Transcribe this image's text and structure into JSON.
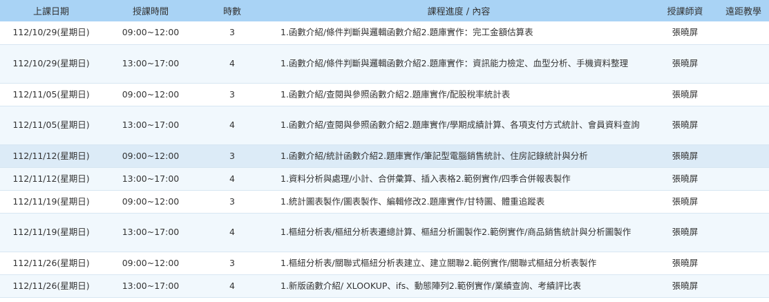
{
  "table": {
    "headers": [
      "上課日期",
      "授課時間",
      "時數",
      "課程進度 / 內容",
      "授課師資",
      "遠距教學"
    ],
    "rows": [
      {
        "date": "112/10/29(星期日)",
        "time": "09:00~12:00",
        "hours": "3",
        "content": "1.函數介紹/條件判斷與邏輯函數介紹2.題庫實作：完工金額估算表",
        "teacher": "張曉屏",
        "remote": ""
      },
      {
        "date": "112/10/29(星期日)",
        "time": "13:00~17:00",
        "hours": "4",
        "content": "1.函數介紹/條件判斷與邏輯函數介紹2.題庫實作：資訊能力檢定、血型分析、手機資料整理",
        "teacher": "張曉屏",
        "remote": ""
      },
      {
        "date": "112/11/05(星期日)",
        "time": "09:00~12:00",
        "hours": "3",
        "content": "1.函數介紹/查閱與參照函數介紹2.題庫實作/配股稅率統計表",
        "teacher": "張曉屏",
        "remote": ""
      },
      {
        "date": "112/11/05(星期日)",
        "time": "13:00~17:00",
        "hours": "4",
        "content": "1.函數介紹/查閱與參照函數介紹2.題庫實作/學期成績計算、各項支付方式統計、會員資料查詢",
        "teacher": "張曉屏",
        "remote": ""
      },
      {
        "date": "112/11/12(星期日)",
        "time": "09:00~12:00",
        "hours": "3",
        "content": "1.函數介紹/統計函數介紹2.題庫實作/筆記型電腦銷售統計、住房記錄統計與分析",
        "teacher": "張曉屏",
        "remote": ""
      },
      {
        "date": "112/11/12(星期日)",
        "time": "13:00~17:00",
        "hours": "4",
        "content": "1.資料分析與處理/小計、合併彙算、插入表格2.範例實作/四季合併報表製作",
        "teacher": "張曉屏",
        "remote": ""
      },
      {
        "date": "112/11/19(星期日)",
        "time": "09:00~12:00",
        "hours": "3",
        "content": "1.統計圖表製作/圖表製作、編輯修改2.題庫實作/甘特圖、體重追蹤表",
        "teacher": "張曉屏",
        "remote": ""
      },
      {
        "date": "112/11/19(星期日)",
        "time": "13:00~17:00",
        "hours": "4",
        "content": "1.樞紐分析表/樞紐分析表遷總計算、樞紐分析圖製作2.範例實作/商品銷售統計與分析圖製作",
        "teacher": "張曉屏",
        "remote": ""
      },
      {
        "date": "112/11/26(星期日)",
        "time": "09:00~12:00",
        "hours": "3",
        "content": "1.樞紐分析表/關聯式樞紐分析表建立、建立關聯2.範例實作/關聯式樞紐分析表製作",
        "teacher": "張曉屏",
        "remote": ""
      },
      {
        "date": "112/11/26(星期日)",
        "time": "13:00~17:00",
        "hours": "4",
        "content": "1.新版函數介紹/ XLOOKUP、ifs、動態陣列2.範例實作/業績查詢、考績評比表",
        "teacher": "張曉屏",
        "remote": ""
      }
    ]
  }
}
